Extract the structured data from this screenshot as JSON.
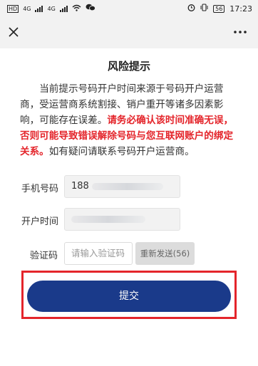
{
  "status_bar": {
    "carrier_left": "HD",
    "network_1": "4G",
    "network_2": "4G",
    "battery": "56",
    "time": "17:23"
  },
  "nav": {
    "close_icon": "close-icon",
    "more_icon": "more-dots-icon"
  },
  "dialog": {
    "title": "风险提示",
    "notice_plain_1": "当前提示号码开户时间来源于号码开户运营商，受运营商系统割接、销户重开等诸多因素影响，可能存在误差。",
    "notice_warning": "请务必确认该时间准确无误，否则可能导致错误解除号码与您互联网账户的绑定关系。",
    "notice_plain_2": "如有疑问请联系号码开户运营商。",
    "warning_color": "#e4252b"
  },
  "form": {
    "phone_label": "手机号码",
    "phone_value": "188",
    "open_time_label": "开户时间",
    "code_label": "验证码",
    "code_placeholder": "请输入验证码",
    "resend_label": "重新发送(56)"
  },
  "submit": {
    "label": "提交",
    "color": "#1a3a8a"
  }
}
